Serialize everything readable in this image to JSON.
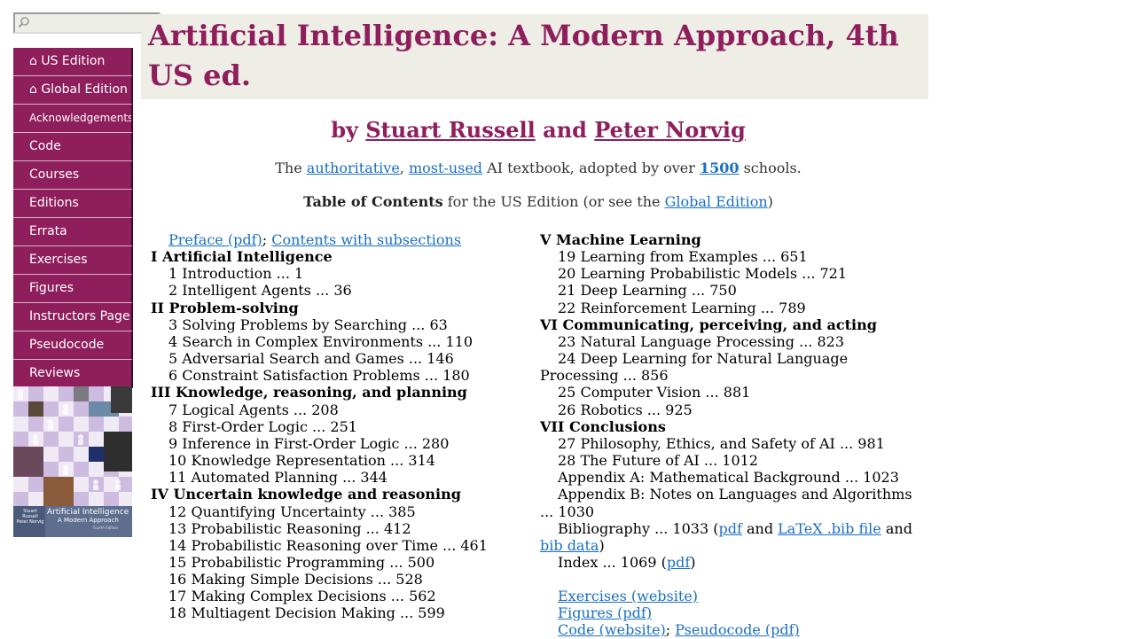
{
  "search": {
    "placeholder": "",
    "value": ""
  },
  "sidebar": {
    "items": [
      {
        "label": "⌂ US Edition",
        "small": false
      },
      {
        "label": "⌂ Global Edition",
        "small": false
      },
      {
        "label": "Acknowledgements",
        "small": true
      },
      {
        "label": "Code",
        "small": false
      },
      {
        "label": "Courses",
        "small": false
      },
      {
        "label": "Editions",
        "small": false
      },
      {
        "label": "Errata",
        "small": false
      },
      {
        "label": "Exercises",
        "small": false
      },
      {
        "label": "Figures",
        "small": false
      },
      {
        "label": "Instructors Page",
        "small": false
      },
      {
        "label": "Pseudocode",
        "small": false
      },
      {
        "label": "Reviews",
        "small": false
      }
    ],
    "cover": {
      "author1": "Stuart Russell",
      "author2": "Peter Norvig",
      "title": "Artificial Intelligence",
      "subtitle": "A Modern Approach",
      "edition": "Fourth Edition"
    }
  },
  "header": {
    "title": "Artificial Intelligence: A Modern Approach, 4th US ed."
  },
  "byline": {
    "by": "by",
    "author1": "Stuart Russell",
    "and": "and",
    "author2": "Peter Norvig"
  },
  "tagline": {
    "pre": "The",
    "link1": "authoritative",
    "comma": ",",
    "link2": "most-used",
    "mid": "AI textbook, adopted by over",
    "link3": "1500",
    "post": "schools."
  },
  "toc_heading": {
    "bold": "Table of Contents",
    "mid": "for the US Edition (or see the",
    "link": "Global Edition",
    "close": ")"
  },
  "toc": {
    "preface_link": "Preface (pdf)",
    "sep": ";",
    "subsections_link": "Contents with subsections",
    "part1": "I Artificial Intelligence",
    "ch1": "1 Introduction ... 1",
    "ch2": "2 Intelligent Agents ... 36",
    "part2": "II Problem-solving",
    "ch3": "3 Solving Problems by Searching ... 63",
    "ch4": "4 Search in Complex Environments ... 110",
    "ch5": "5 Adversarial Search and Games ... 146",
    "ch6": "6 Constraint Satisfaction Problems ... 180",
    "part3": "III Knowledge, reasoning, and planning",
    "ch7": "7 Logical Agents ... 208",
    "ch8": "8 First-Order Logic ... 251",
    "ch9": "9 Inference in First-Order Logic ... 280",
    "ch10": "10 Knowledge Representation ... 314",
    "ch11": "11 Automated Planning ... 344",
    "part4": "IV Uncertain knowledge and reasoning",
    "ch12": "12 Quantifying Uncertainty ... 385",
    "ch13": "13 Probabilistic Reasoning ... 412",
    "ch14": "14 Probabilistic Reasoning over Time ... 461",
    "ch15": "15 Probabilistic Programming ... 500",
    "ch16": "16 Making Simple Decisions ... 528",
    "ch17": "17 Making Complex Decisions ... 562",
    "ch18": "18 Multiagent Decision Making ... 599",
    "part5": "V Machine Learning",
    "ch19": "19 Learning from Examples ... 651",
    "ch20": "20 Learning Probabilistic Models ... 721",
    "ch21": "21 Deep Learning ... 750",
    "ch22": "22 Reinforcement Learning ... 789",
    "part6": "VI Communicating, perceiving, and acting",
    "ch23": "23 Natural Language Processing ... 823",
    "ch24": "24 Deep Learning for Natural Language Processing ... 856",
    "ch25": "25 Computer Vision ... 881",
    "ch26": "26 Robotics ... 925",
    "part7": "VII Conclusions",
    "ch27": "27 Philosophy, Ethics, and Safety of AI ... 981",
    "ch28": "28 The Future of AI ... 1012",
    "appA": "Appendix A: Mathematical Background ... 1023",
    "appB": "Appendix B: Notes on Languages and Algorithms ... 1030",
    "biblio_pre": "Bibliography ... 1033 (",
    "biblio_pdf": "pdf",
    "biblio_and1": "and",
    "biblio_latex": "LaTeX .bib file",
    "biblio_and2": "and",
    "biblio_data": "bib data",
    "biblio_close": ")",
    "index_pre": "Index ... 1069 (",
    "index_pdf": "pdf",
    "index_close": ")",
    "exercises_link": "Exercises (website)",
    "figures_link": "Figures (pdf)",
    "code_link": "Code (website)",
    "sep2": ";",
    "pseudocode_link": "Pseudocode (pdf)"
  },
  "colors": {
    "brand": "#8f1e5c",
    "header_bg": "#eeeee6",
    "link": "#1a6fc4"
  }
}
